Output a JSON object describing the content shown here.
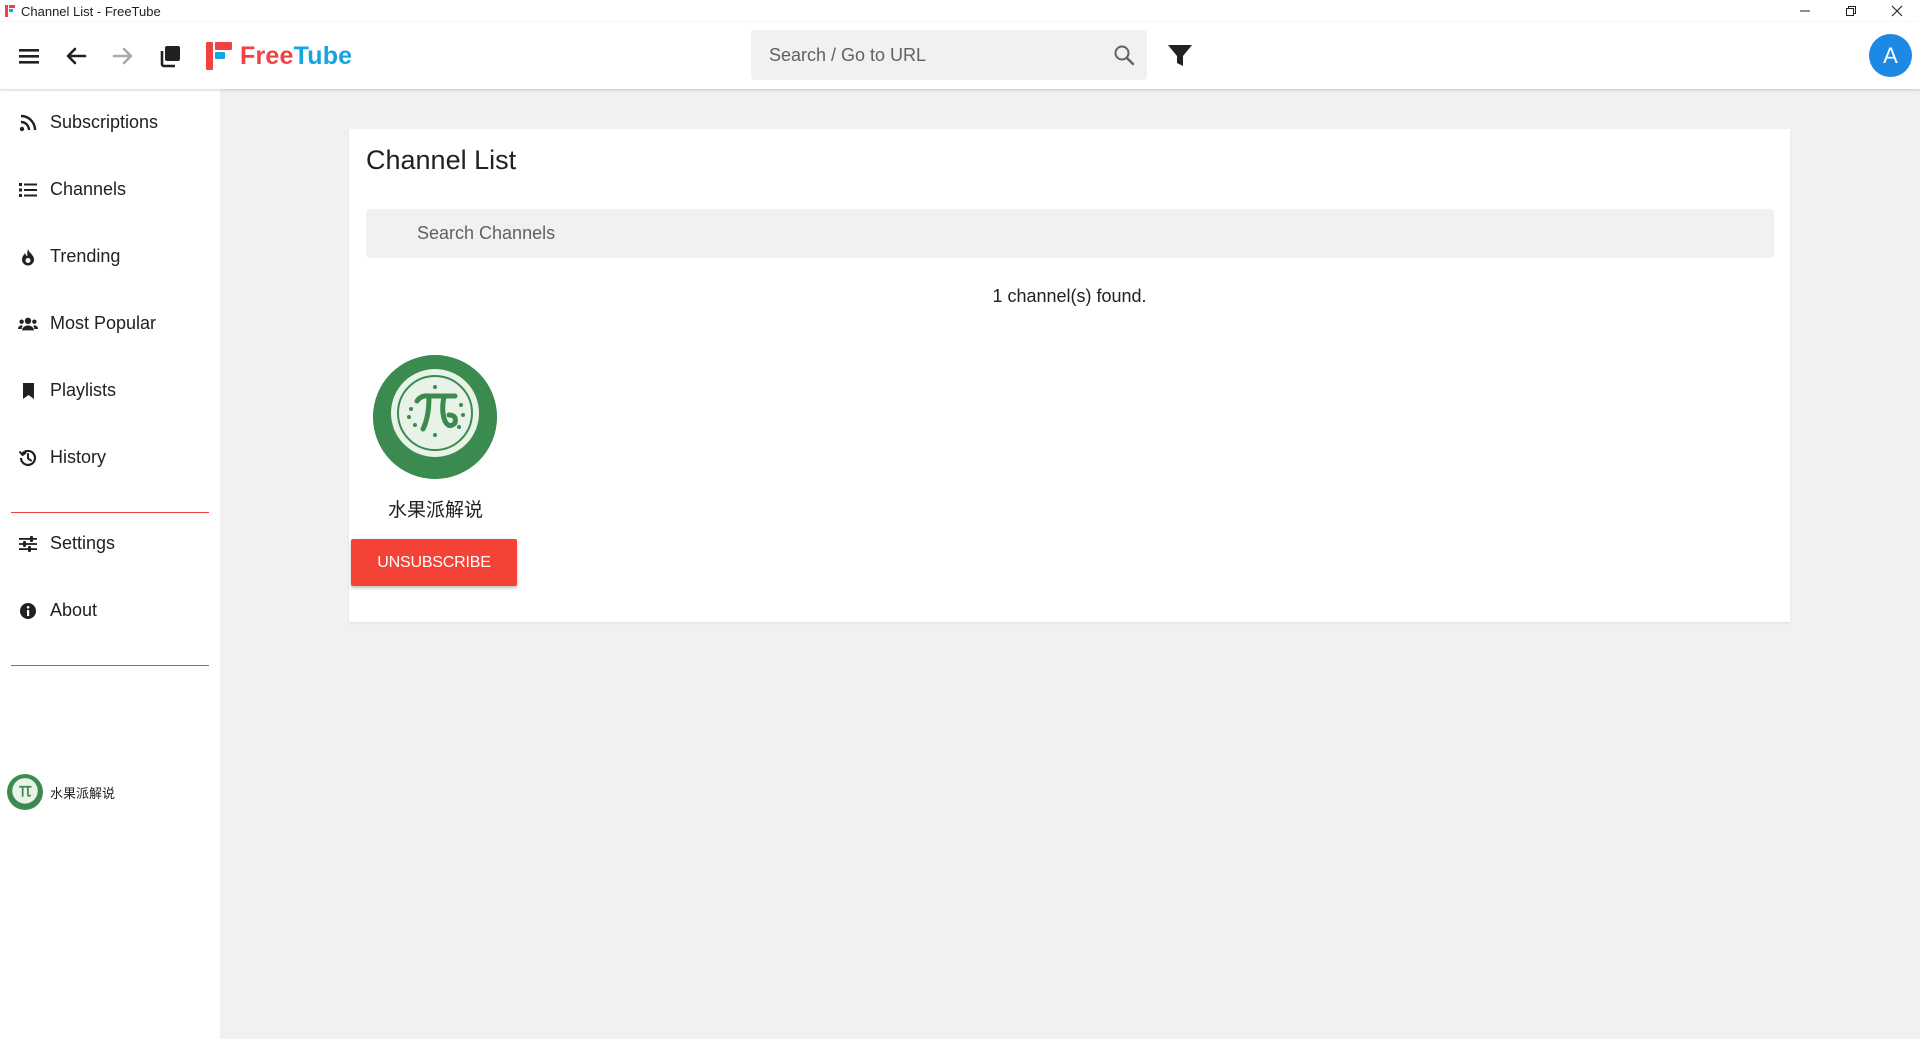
{
  "window": {
    "title": "Channel List - FreeTube",
    "controls": {
      "minimize": "—",
      "restore": "❐",
      "close": "✕"
    }
  },
  "topnav": {
    "logo_free": "Free",
    "logo_tube": "Tube",
    "search_placeholder": "Search / Go to URL",
    "avatar_letter": "A",
    "accent_color": "#f04242",
    "brand_blue": "#14a4df",
    "icons": [
      "menu-icon",
      "back-arrow-icon",
      "forward-arrow-icon",
      "new-window-icon",
      "search-icon",
      "filter-icon"
    ]
  },
  "sidebar": {
    "items": [
      {
        "label": "Subscriptions",
        "icon": "rss-icon"
      },
      {
        "label": "Channels",
        "icon": "list-icon"
      },
      {
        "label": "Trending",
        "icon": "fire-icon"
      },
      {
        "label": "Most Popular",
        "icon": "users-icon"
      },
      {
        "label": "Playlists",
        "icon": "bookmark-icon"
      },
      {
        "label": "History",
        "icon": "history-icon"
      },
      {
        "label": "Settings",
        "icon": "sliders-icon"
      },
      {
        "label": "About",
        "icon": "info-icon"
      }
    ],
    "subscriptions": [
      {
        "name": "水果派解说"
      }
    ]
  },
  "main": {
    "title": "Channel List",
    "search_placeholder": "Search Channels",
    "found_text": "1 channel(s) found.",
    "channels": [
      {
        "name": "水果派解说",
        "button": "UNSUBSCRIBE"
      }
    ],
    "unsubscribe_color": "#f44336"
  }
}
